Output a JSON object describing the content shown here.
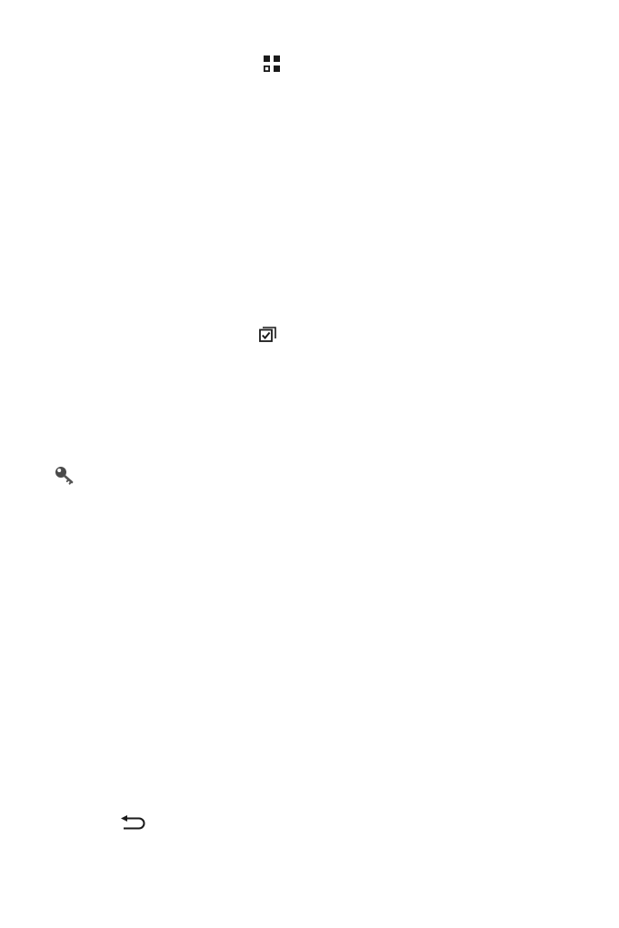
{
  "icons": {
    "apps_grid": "apps-grid-icon",
    "stacked_checkbox": "stacked-checkbox-icon",
    "key": "key-icon",
    "back_arrow": "back-arrow-icon"
  },
  "colors": {
    "background": "#ffffff",
    "icon": "#1a1a1a"
  }
}
